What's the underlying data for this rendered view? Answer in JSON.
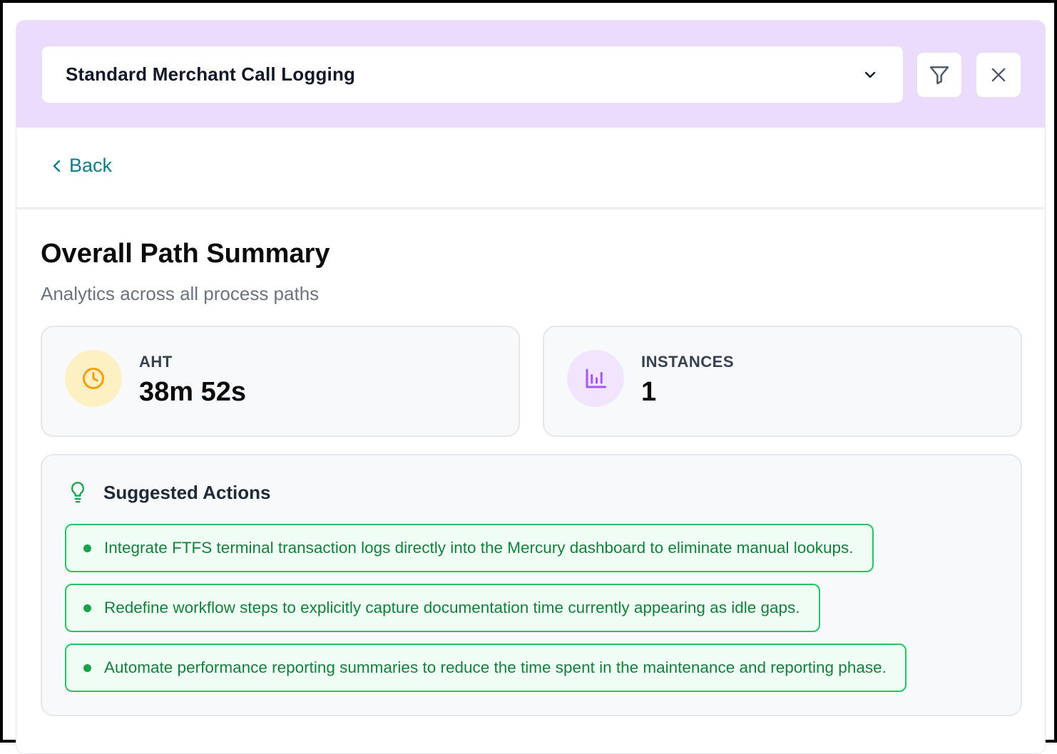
{
  "header": {
    "process_select": {
      "value": "Standard Merchant Call Logging"
    },
    "filter_icon": "filter-icon",
    "close_icon": "close-icon"
  },
  "nav": {
    "back_label": "Back"
  },
  "summary": {
    "title": "Overall Path Summary",
    "subtitle": "Analytics across all process paths",
    "stats": [
      {
        "label": "AHT",
        "value": "38m 52s",
        "icon": "clock-icon",
        "color": "#f59e0b"
      },
      {
        "label": "INSTANCES",
        "value": "1",
        "icon": "bar-chart-icon",
        "color": "#a855f7"
      }
    ]
  },
  "suggested_actions": {
    "title": "Suggested Actions",
    "icon": "lightbulb-icon",
    "items": [
      "Integrate FTFS terminal transaction logs directly into the Mercury dashboard to eliminate manual lookups.",
      "Redefine workflow steps to explicitly capture documentation time currently appearing as idle gaps.",
      "Automate performance reporting summaries to reduce the time spent in the maintenance and reporting phase."
    ]
  },
  "colors": {
    "header_bg": "#ebdcfc",
    "accent_link": "#0f7c87",
    "action_border": "#22c55e",
    "action_text": "#15803d"
  }
}
